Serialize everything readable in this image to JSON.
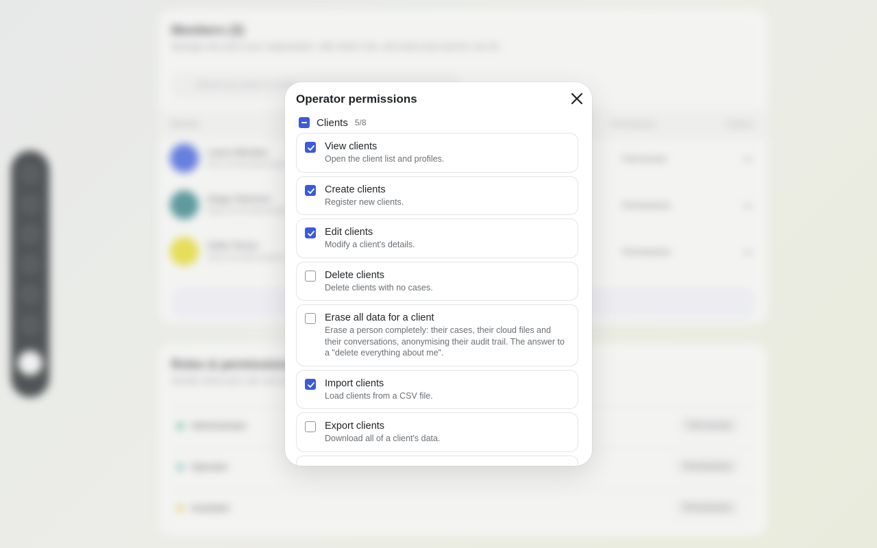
{
  "background": {
    "members_title": "Members (3)",
    "members_sub": "Manage who joins your organization, with which role, and what each person can do.",
    "search_placeholder": "Search by name or email",
    "col_member": "Member",
    "col_permissions": "Permissions",
    "col_actions": "Actions",
    "rows": [
      {
        "name": "Laura Méndez",
        "email": "laura.mendez@example.com",
        "perm": "Full access"
      },
      {
        "name": "Diego Ramírez",
        "email": "diego.ramirez@example.com",
        "perm": "Permissions"
      },
      {
        "name": "Sofía Torres",
        "email": "sofia.torres@example.com",
        "perm": "Permissions"
      }
    ],
    "roles_title": "Roles & permissions",
    "roles_sub": "Decide what each role can access",
    "roles": [
      {
        "name": "Administrator",
        "perm": "Full access",
        "color": "#3aa37a"
      },
      {
        "name": "Operator",
        "perm": "Permissions",
        "color": "#5aa8a0"
      },
      {
        "name": "Assistant",
        "perm": "Permissions",
        "color": "#e7b93c"
      }
    ]
  },
  "modal": {
    "title": "Operator permissions",
    "accent": "#3b5bdb",
    "group": {
      "label": "Clients",
      "count": "5/8",
      "state": "indeterminate"
    },
    "permissions": [
      {
        "title": "View clients",
        "description": "Open the client list and profiles.",
        "checked": true
      },
      {
        "title": "Create clients",
        "description": "Register new clients.",
        "checked": true
      },
      {
        "title": "Edit clients",
        "description": "Modify a client's details.",
        "checked": true
      },
      {
        "title": "Delete clients",
        "description": "Delete clients with no cases.",
        "checked": false
      },
      {
        "title": "Erase all data for a client",
        "description": "Erase a person completely: their cases, their cloud files and their conversations, anonymising their audit trail. The answer to a \"delete everything about me\".",
        "checked": false
      },
      {
        "title": "Import clients",
        "description": "Load clients from a CSV file.",
        "checked": true
      },
      {
        "title": "Export clients",
        "description": "Download all of a client's data.",
        "checked": false
      }
    ]
  }
}
